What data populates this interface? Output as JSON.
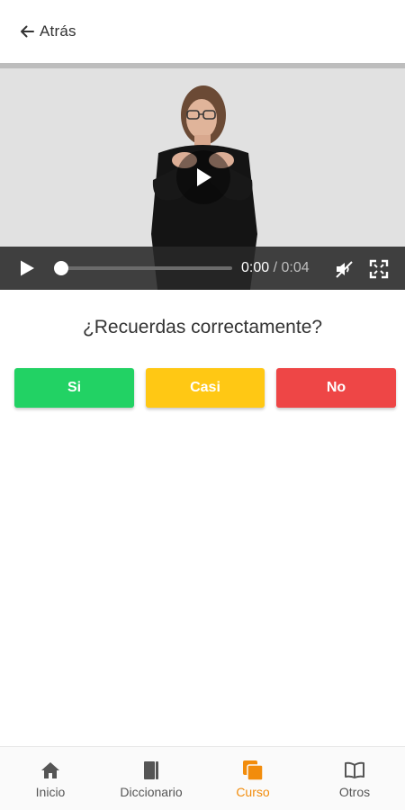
{
  "header": {
    "back_label": "Atrás"
  },
  "video": {
    "current_time": "0:00",
    "separator": "/",
    "duration": "0:04",
    "progress": 0
  },
  "question": "¿Recuerdas correctamente?",
  "answers": [
    {
      "label": "Si",
      "color": "#22d264"
    },
    {
      "label": "Casi",
      "color": "#ffc814"
    },
    {
      "label": "No",
      "color": "#ee4646"
    }
  ],
  "bottom_nav": {
    "active": "Curso",
    "active_color": "#f28c0c",
    "items": [
      {
        "label": "Inicio",
        "icon": "home-icon"
      },
      {
        "label": "Diccionario",
        "icon": "dictionary-icon"
      },
      {
        "label": "Curso",
        "icon": "course-icon"
      },
      {
        "label": "Otros",
        "icon": "book-open-icon"
      }
    ]
  }
}
